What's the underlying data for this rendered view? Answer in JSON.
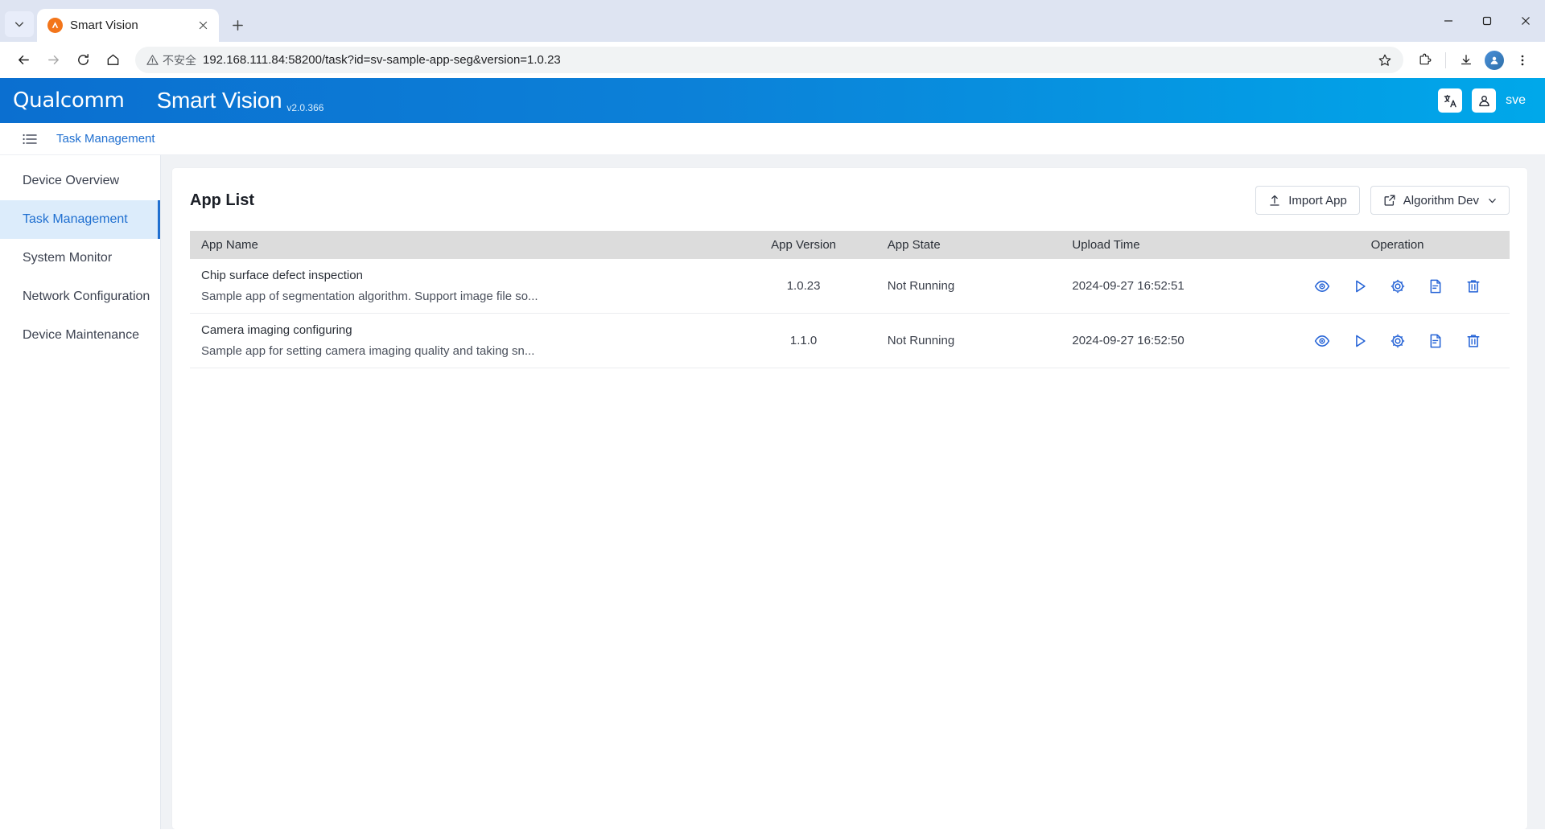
{
  "browser": {
    "tab": {
      "title": "Smart Vision",
      "favicon": "smart-vision-favicon"
    },
    "new_tab_label": "+",
    "url": "192.168.111.84:58200/task?id=sv-sample-app-seg&version=1.0.23",
    "security_label": "不安全",
    "profile_initial": "",
    "window_controls": {
      "minimize": "minimize",
      "maximize": "maximize",
      "close": "close"
    }
  },
  "header": {
    "brand": "Qualcomm",
    "product": "Smart Vision",
    "version": "v2.0.366",
    "translate_icon": "translate-icon",
    "user_icon": "user-icon",
    "user_name": "sve"
  },
  "breadcrumb": {
    "menu_icon": "list-menu-icon",
    "text": "Task Management"
  },
  "sidebar": {
    "items": [
      {
        "label": "Device Overview",
        "active": false
      },
      {
        "label": "Task Management",
        "active": true
      },
      {
        "label": "System Monitor",
        "active": false
      },
      {
        "label": "Network Configuration",
        "active": false
      },
      {
        "label": "Device Maintenance",
        "active": false
      }
    ]
  },
  "main": {
    "card_title": "App List",
    "buttons": {
      "import": {
        "label": "Import App",
        "icon": "upload-icon"
      },
      "algorithm_dev": {
        "label": "Algorithm Dev",
        "icon": "external-link-icon",
        "caret": "chevron-down-icon"
      }
    },
    "table": {
      "columns": [
        "App Name",
        "App Version",
        "App State",
        "Upload Time",
        "Operation"
      ],
      "rows": [
        {
          "name": "Chip surface defect inspection",
          "description": "Sample app of segmentation algorithm. Support image file so...",
          "version": "1.0.23",
          "state": "Not Running",
          "upload_time": "2024-09-27 16:52:51",
          "operations": [
            "view-icon",
            "run-icon",
            "settings-icon",
            "log-icon",
            "delete-icon"
          ]
        },
        {
          "name": "Camera imaging configuring",
          "description": "Sample app for setting camera imaging quality and taking sn...",
          "version": "1.1.0",
          "state": "Not Running",
          "upload_time": "2024-09-27 16:52:50",
          "operations": [
            "view-icon",
            "run-icon",
            "settings-icon",
            "log-icon",
            "delete-icon"
          ]
        }
      ]
    }
  },
  "colors": {
    "brand_blue": "#0c81d8",
    "accent_blue": "#1f6fd0",
    "icon_blue": "#2563d6",
    "sidebar_active_bg": "#dcecfb",
    "table_header_bg": "#dcdcdc"
  }
}
